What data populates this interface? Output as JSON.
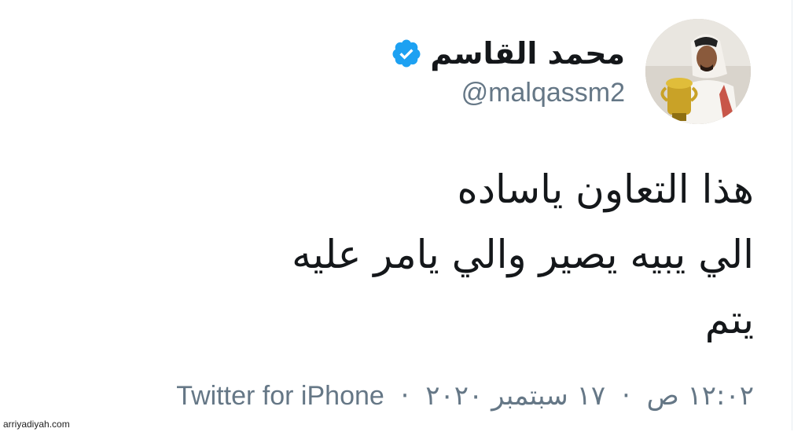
{
  "user": {
    "display_name": "محمد القاسم",
    "handle": "@malqassm2",
    "verified_icon": "verified-badge-icon",
    "verified_color": "#1da1f2"
  },
  "tweet": {
    "lines": [
      "هذا التعاون ياساده",
      "الي يبيه يصير والي يامر عليه",
      "يتم"
    ]
  },
  "meta": {
    "time": "١٢:٠٢ ص",
    "date": "١٧ سبتمبر ٢٠٢٠",
    "separator": "·",
    "source": "Twitter for iPhone"
  },
  "watermark": "arriyadiyah.com",
  "colors": {
    "text": "#14171a",
    "secondary": "#657786",
    "accent": "#1da1f2"
  }
}
